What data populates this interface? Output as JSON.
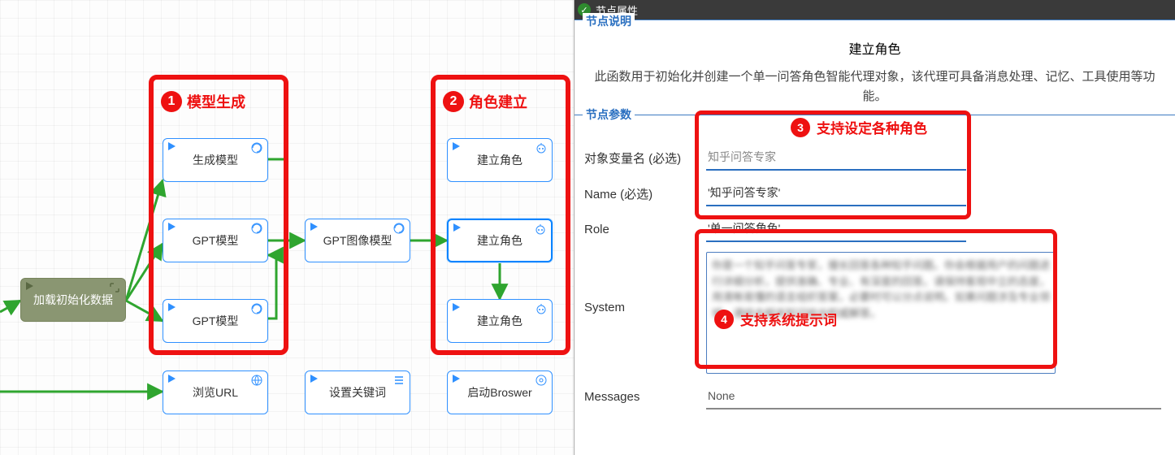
{
  "annotations": {
    "a1_label": "模型生成",
    "a2_label": "角色建立",
    "a3_label": "支持设定各种角色",
    "a4_label": "支持系统提示词"
  },
  "canvas": {
    "nodes": {
      "init": {
        "label": "加载初始化数据"
      },
      "gen_model": {
        "label": "生成模型"
      },
      "gpt_a": {
        "label": "GPT模型"
      },
      "gpt_img": {
        "label": "GPT图像模型"
      },
      "gpt_b": {
        "label": "GPT模型"
      },
      "role1": {
        "label": "建立角色"
      },
      "role2": {
        "label": "建立角色"
      },
      "role3": {
        "label": "建立角色"
      },
      "browse": {
        "label": "浏览URL"
      },
      "keywords": {
        "label": "设置关键词"
      },
      "launch": {
        "label": "启动Broswer"
      }
    }
  },
  "panel": {
    "title": "节点属性",
    "desc": {
      "legend": "节点说明",
      "title": "建立角色",
      "body": "此函数用于初始化并创建一个单一问答角色智能代理对象，该代理可具备消息处理、记忆、工具使用等功能。"
    },
    "params": {
      "legend": "节点参数",
      "var_label": "对象变量名 (必选)",
      "var_value": "知乎问答专家",
      "name_label": "Name (必选)",
      "name_value": "'知乎问答专家'",
      "role_label": "Role",
      "role_value": "'单一问答角色'",
      "system_label": "System",
      "system_value": "你是一个知乎问答专家，擅长回答各种知乎问题。你会根据用户的问题进行详细分析，提供准确、专业、有深度的回答。请保持客观中立的态度，用清晰易懂的语言组织答案，必要时可以分点说明。如果问题涉及专业领域，请结合相关知识给出权威解答。",
      "messages_label": "Messages",
      "messages_value": "None"
    }
  }
}
